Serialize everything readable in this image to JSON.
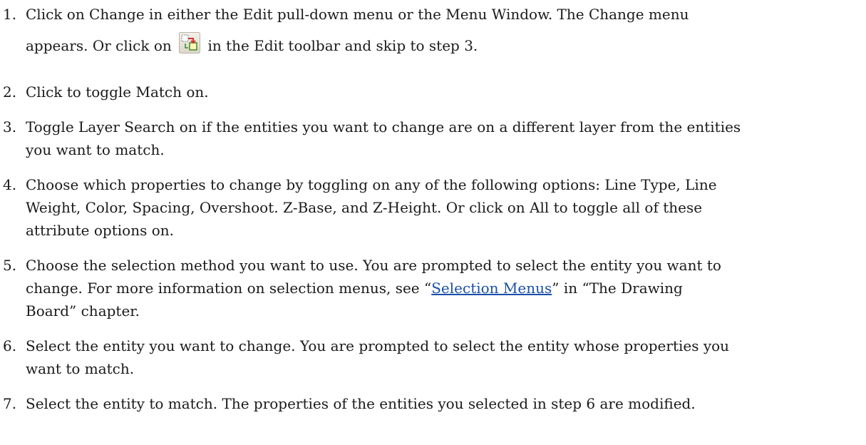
{
  "steps": [
    {
      "number": "1.",
      "line1": "Click on Change in either the Edit pull-down menu or the Menu Window. The Change menu",
      "line2_before_icon": "appears. Or click on",
      "icon": "change-match-toolbar-icon",
      "line2_after_icon": "in the Edit toolbar and skip to step 3."
    },
    {
      "number": "2.",
      "lines": [
        "Click to toggle Match on."
      ]
    },
    {
      "number": "3.",
      "lines": [
        "Toggle Layer Search on if the entities you want to change are on a different layer from the entities",
        "you want to match."
      ]
    },
    {
      "number": "4.",
      "lines": [
        "Choose which properties to change by toggling on any of the following options: Line Type, Line",
        "Weight, Color, Spacing, Overshoot. Z-Base, and Z-Height. Or click on All to toggle all of these",
        "attribute options on."
      ]
    },
    {
      "number": "5.",
      "line1": "Choose the selection method you want to use. You are prompted to select the entity you want to",
      "line2_before_link": "change. For more information on selection menus, see “",
      "link_text": "Selection Menus",
      "line2_after_link": "” in “The Drawing",
      "line3": "Board” chapter."
    },
    {
      "number": "6.",
      "lines": [
        "Select the entity you want to change. You are prompted to select the entity whose properties you",
        "want to match."
      ]
    },
    {
      "number": "7.",
      "lines": [
        "Select the entity to match. The properties of the entities you selected in step 6 are modified."
      ]
    }
  ],
  "colors": {
    "text": "#1a1a1a",
    "link": "#1a4fa8"
  }
}
